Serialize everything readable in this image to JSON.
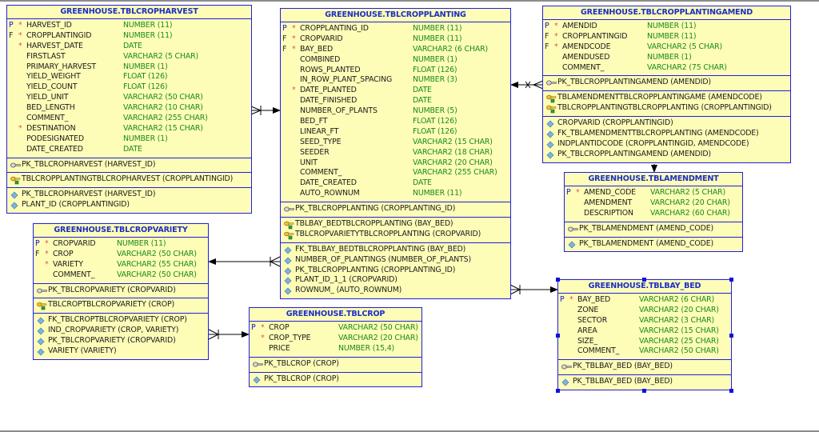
{
  "diagram": {
    "tables": {
      "cropharvest": {
        "title": "GREENHOUSE.TBLCROPHARVEST",
        "columns": [
          {
            "key": "P",
            "mandatory": "*",
            "name": "HARVEST_ID",
            "type": "NUMBER (11)"
          },
          {
            "key": "F",
            "mandatory": "*",
            "name": "CROPPLANTINGID",
            "type": "NUMBER (11)"
          },
          {
            "key": "",
            "mandatory": "*",
            "name": "HARVEST_DATE",
            "type": "DATE"
          },
          {
            "key": "",
            "mandatory": "",
            "name": "FIRSTLAST",
            "type": "VARCHAR2 (5 CHAR)"
          },
          {
            "key": "",
            "mandatory": "",
            "name": "PRIMARY_HARVEST",
            "type": "NUMBER (1)"
          },
          {
            "key": "",
            "mandatory": "",
            "name": "YIELD_WEIGHT",
            "type": "FLOAT (126)"
          },
          {
            "key": "",
            "mandatory": "",
            "name": "YIELD_COUNT",
            "type": "FLOAT (126)"
          },
          {
            "key": "",
            "mandatory": "",
            "name": "YIELD_UNIT",
            "type": "VARCHAR2 (50 CHAR)"
          },
          {
            "key": "",
            "mandatory": "",
            "name": "BED_LENGTH",
            "type": "VARCHAR2 (10 CHAR)"
          },
          {
            "key": "",
            "mandatory": "",
            "name": "COMMENT_",
            "type": "VARCHAR2 (255 CHAR)"
          },
          {
            "key": "",
            "mandatory": "*",
            "name": "DESTINATION",
            "type": "VARCHAR2 (15 CHAR)"
          },
          {
            "key": "",
            "mandatory": "",
            "name": "PODESIGNATED",
            "type": "NUMBER (1)"
          },
          {
            "key": "",
            "mandatory": "",
            "name": "DATE_CREATED",
            "type": "DATE"
          }
        ],
        "primary_keys": [
          "PK_TBLCROPHARVEST (HARVEST_ID)"
        ],
        "foreign_keys": [
          "TBLCROPPLANTINGTBLCROPHARVEST (CROPPLANTINGID)"
        ],
        "indexes": [
          "PK_TBLCROPHARVEST (HARVEST_ID)",
          "PLANT_ID (CROPPLANTINGID)"
        ]
      },
      "cropplanting": {
        "title": "GREENHOUSE.TBLCROPPLANTING",
        "columns": [
          {
            "key": "P",
            "mandatory": "*",
            "name": "CROPPLANTING_ID",
            "type": "NUMBER (11)"
          },
          {
            "key": "F",
            "mandatory": "*",
            "name": "CROPVARID",
            "type": "NUMBER (11)"
          },
          {
            "key": "F",
            "mandatory": "*",
            "name": "BAY_BED",
            "type": "VARCHAR2 (6 CHAR)"
          },
          {
            "key": "",
            "mandatory": "",
            "name": "COMBINED",
            "type": "NUMBER (1)"
          },
          {
            "key": "",
            "mandatory": "",
            "name": "ROWS_PLANTED",
            "type": "FLOAT (126)"
          },
          {
            "key": "",
            "mandatory": "",
            "name": "IN_ROW_PLANT_SPACING",
            "type": "NUMBER (3)"
          },
          {
            "key": "",
            "mandatory": "*",
            "name": "DATE_PLANTED",
            "type": "DATE"
          },
          {
            "key": "",
            "mandatory": "",
            "name": "DATE_FINISHED",
            "type": "DATE"
          },
          {
            "key": "",
            "mandatory": "",
            "name": "NUMBER_OF_PLANTS",
            "type": "NUMBER (5)"
          },
          {
            "key": "",
            "mandatory": "",
            "name": "BED_FT",
            "type": "FLOAT (126)"
          },
          {
            "key": "",
            "mandatory": "",
            "name": "LINEAR_FT",
            "type": "FLOAT (126)"
          },
          {
            "key": "",
            "mandatory": "",
            "name": "SEED_TYPE",
            "type": "VARCHAR2 (15 CHAR)"
          },
          {
            "key": "",
            "mandatory": "",
            "name": "SEEDER",
            "type": "VARCHAR2 (18 CHAR)"
          },
          {
            "key": "",
            "mandatory": "",
            "name": "UNIT",
            "type": "VARCHAR2 (20 CHAR)"
          },
          {
            "key": "",
            "mandatory": "",
            "name": "COMMENT_",
            "type": "VARCHAR2 (255 CHAR)"
          },
          {
            "key": "",
            "mandatory": "",
            "name": "DATE_CREATED",
            "type": "DATE"
          },
          {
            "key": "",
            "mandatory": "",
            "name": "AUTO_ROWNUM",
            "type": "NUMBER (11)"
          }
        ],
        "primary_keys": [
          "PK_TBLCROPPLANTING (CROPPLANTING_ID)"
        ],
        "foreign_keys": [
          "TBLBAY_BEDTBLCROPPLANTING (BAY_BED)",
          "TBLCROPVARIETYTBLCROPPLANTING (CROPVARID)"
        ],
        "indexes": [
          "FK_TBLBAY_BEDTBLCROPPLANTING (BAY_BED)",
          "NUMBER_OF_PLANTINGS (NUMBER_OF_PLANTS)",
          "PK_TBLCROPPLANTING (CROPPLANTING_ID)",
          "PLANT_ID_1_1 (CROPVARID)",
          "ROWNUM_ (AUTO_ROWNUM)"
        ]
      },
      "cropplantingamend": {
        "title": "GREENHOUSE.TBLCROPPLANTINGAMEND",
        "columns": [
          {
            "key": "P",
            "mandatory": "*",
            "name": "AMENDID",
            "type": "NUMBER (11)"
          },
          {
            "key": "F",
            "mandatory": "*",
            "name": "CROPPLANTINGID",
            "type": "NUMBER (11)"
          },
          {
            "key": "F",
            "mandatory": "*",
            "name": "AMENDCODE",
            "type": "VARCHAR2 (5 CHAR)"
          },
          {
            "key": "",
            "mandatory": "",
            "name": "AMENDUSED",
            "type": "NUMBER (1)"
          },
          {
            "key": "",
            "mandatory": "",
            "name": "COMMENT_",
            "type": "VARCHAR2 (75 CHAR)"
          }
        ],
        "primary_keys": [
          "PK_TBLCROPPLANTINGAMEND (AMENDID)"
        ],
        "foreign_keys": [
          "TBLAMENDMENTTBLCROPPLANTINGAME (AMENDCODE)",
          "TBLCROPPLANTINGTBLCROPPLANTING (CROPPLANTINGID)"
        ],
        "indexes": [
          "CROPVARID (CROPPLANTINGID)",
          "FK_TBLAMENDMENTTBLCROPPLANTING (AMENDCODE)",
          "INDPLANTIDCODE (CROPPLANTINGID, AMENDCODE)",
          "PK_TBLCROPPLANTINGAMEND (AMENDID)"
        ]
      },
      "amendment": {
        "title": "GREENHOUSE.TBLAMENDMENT",
        "columns": [
          {
            "key": "P",
            "mandatory": "*",
            "name": "AMEND_CODE",
            "type": "VARCHAR2 (5 CHAR)"
          },
          {
            "key": "",
            "mandatory": "",
            "name": "AMENDMENT",
            "type": "VARCHAR2 (20 CHAR)"
          },
          {
            "key": "",
            "mandatory": "",
            "name": "DESCRIPTION",
            "type": "VARCHAR2 (60 CHAR)"
          }
        ],
        "primary_keys": [
          "PK_TBLAMENDMENT (AMEND_CODE)"
        ],
        "foreign_keys": [],
        "indexes": [
          "PK_TBLAMENDMENT (AMEND_CODE)"
        ]
      },
      "cropvariety": {
        "title": "GREENHOUSE.TBLCROPVARIETY",
        "columns": [
          {
            "key": "P",
            "mandatory": "*",
            "name": "CROPVARID",
            "type": "NUMBER (11)"
          },
          {
            "key": "F",
            "mandatory": "*",
            "name": "CROP",
            "type": "VARCHAR2 (50 CHAR)"
          },
          {
            "key": "",
            "mandatory": "*",
            "name": "VARIETY",
            "type": "VARCHAR2 (55 CHAR)"
          },
          {
            "key": "",
            "mandatory": "",
            "name": "COMMENT_",
            "type": "VARCHAR2 (50 CHAR)"
          }
        ],
        "primary_keys": [
          "PK_TBLCROPVARIETY (CROPVARID)"
        ],
        "foreign_keys": [
          "TBLCROPTBLCROPVARIETY (CROP)"
        ],
        "indexes": [
          "FK_TBLCROPTBLCROPVARIETY (CROP)",
          "IND_CROPVARIETY (CROP, VARIETY)",
          "PK_TBLCROPVARIETY (CROPVARID)",
          "VARIETY (VARIETY)"
        ]
      },
      "crop": {
        "title": "GREENHOUSE.TBLCROP",
        "columns": [
          {
            "key": "P",
            "mandatory": "*",
            "name": "CROP",
            "type": "VARCHAR2 (50 CHAR)"
          },
          {
            "key": "",
            "mandatory": "*",
            "name": "CROP_TYPE",
            "type": "VARCHAR2 (20 CHAR)"
          },
          {
            "key": "",
            "mandatory": "",
            "name": "PRICE",
            "type": "NUMBER (15,4)"
          }
        ],
        "primary_keys": [
          "PK_TBLCROP (CROP)"
        ],
        "foreign_keys": [],
        "indexes": [
          "PK_TBLCROP (CROP)"
        ]
      },
      "baybed": {
        "title": "GREENHOUSE.TBLBAY_BED",
        "selected": true,
        "columns": [
          {
            "key": "P",
            "mandatory": "*",
            "name": "BAY_BED",
            "type": "VARCHAR2 (6 CHAR)"
          },
          {
            "key": "",
            "mandatory": "",
            "name": "ZONE",
            "type": "VARCHAR2 (20 CHAR)"
          },
          {
            "key": "",
            "mandatory": "",
            "name": "SECTOR",
            "type": "VARCHAR2 (3 CHAR)"
          },
          {
            "key": "",
            "mandatory": "",
            "name": "AREA",
            "type": "VARCHAR2 (15 CHAR)"
          },
          {
            "key": "",
            "mandatory": "",
            "name": "SIZE_",
            "type": "VARCHAR2 (25 CHAR)"
          },
          {
            "key": "",
            "mandatory": "",
            "name": "COMMENT_",
            "type": "VARCHAR2 (50 CHAR)"
          }
        ],
        "primary_keys": [
          "PK_TBLBAY_BED (BAY_BED)"
        ],
        "foreign_keys": [],
        "indexes": [
          "PK_TBLBAY_BED (BAY_BED)"
        ]
      }
    },
    "relationships": [
      {
        "from": "cropharvest",
        "to": "cropplanting",
        "type": "many-to-one"
      },
      {
        "from": "cropplantingamend",
        "to": "cropplanting",
        "type": "many-to-one"
      },
      {
        "from": "cropplantingamend",
        "to": "amendment",
        "type": "many-to-one"
      },
      {
        "from": "cropplanting",
        "to": "cropvariety",
        "type": "many-to-one"
      },
      {
        "from": "cropvariety",
        "to": "crop",
        "type": "many-to-one"
      },
      {
        "from": "cropplanting",
        "to": "baybed",
        "type": "many-to-one"
      }
    ],
    "colors": {
      "table_fill": "#fdfdb8",
      "table_border": "#2020e0",
      "title_text": "#1c2ec8",
      "type_text": "#1a8a1a",
      "mandatory_marker": "#e05050",
      "primary_key_marker": "#1515d0"
    }
  }
}
